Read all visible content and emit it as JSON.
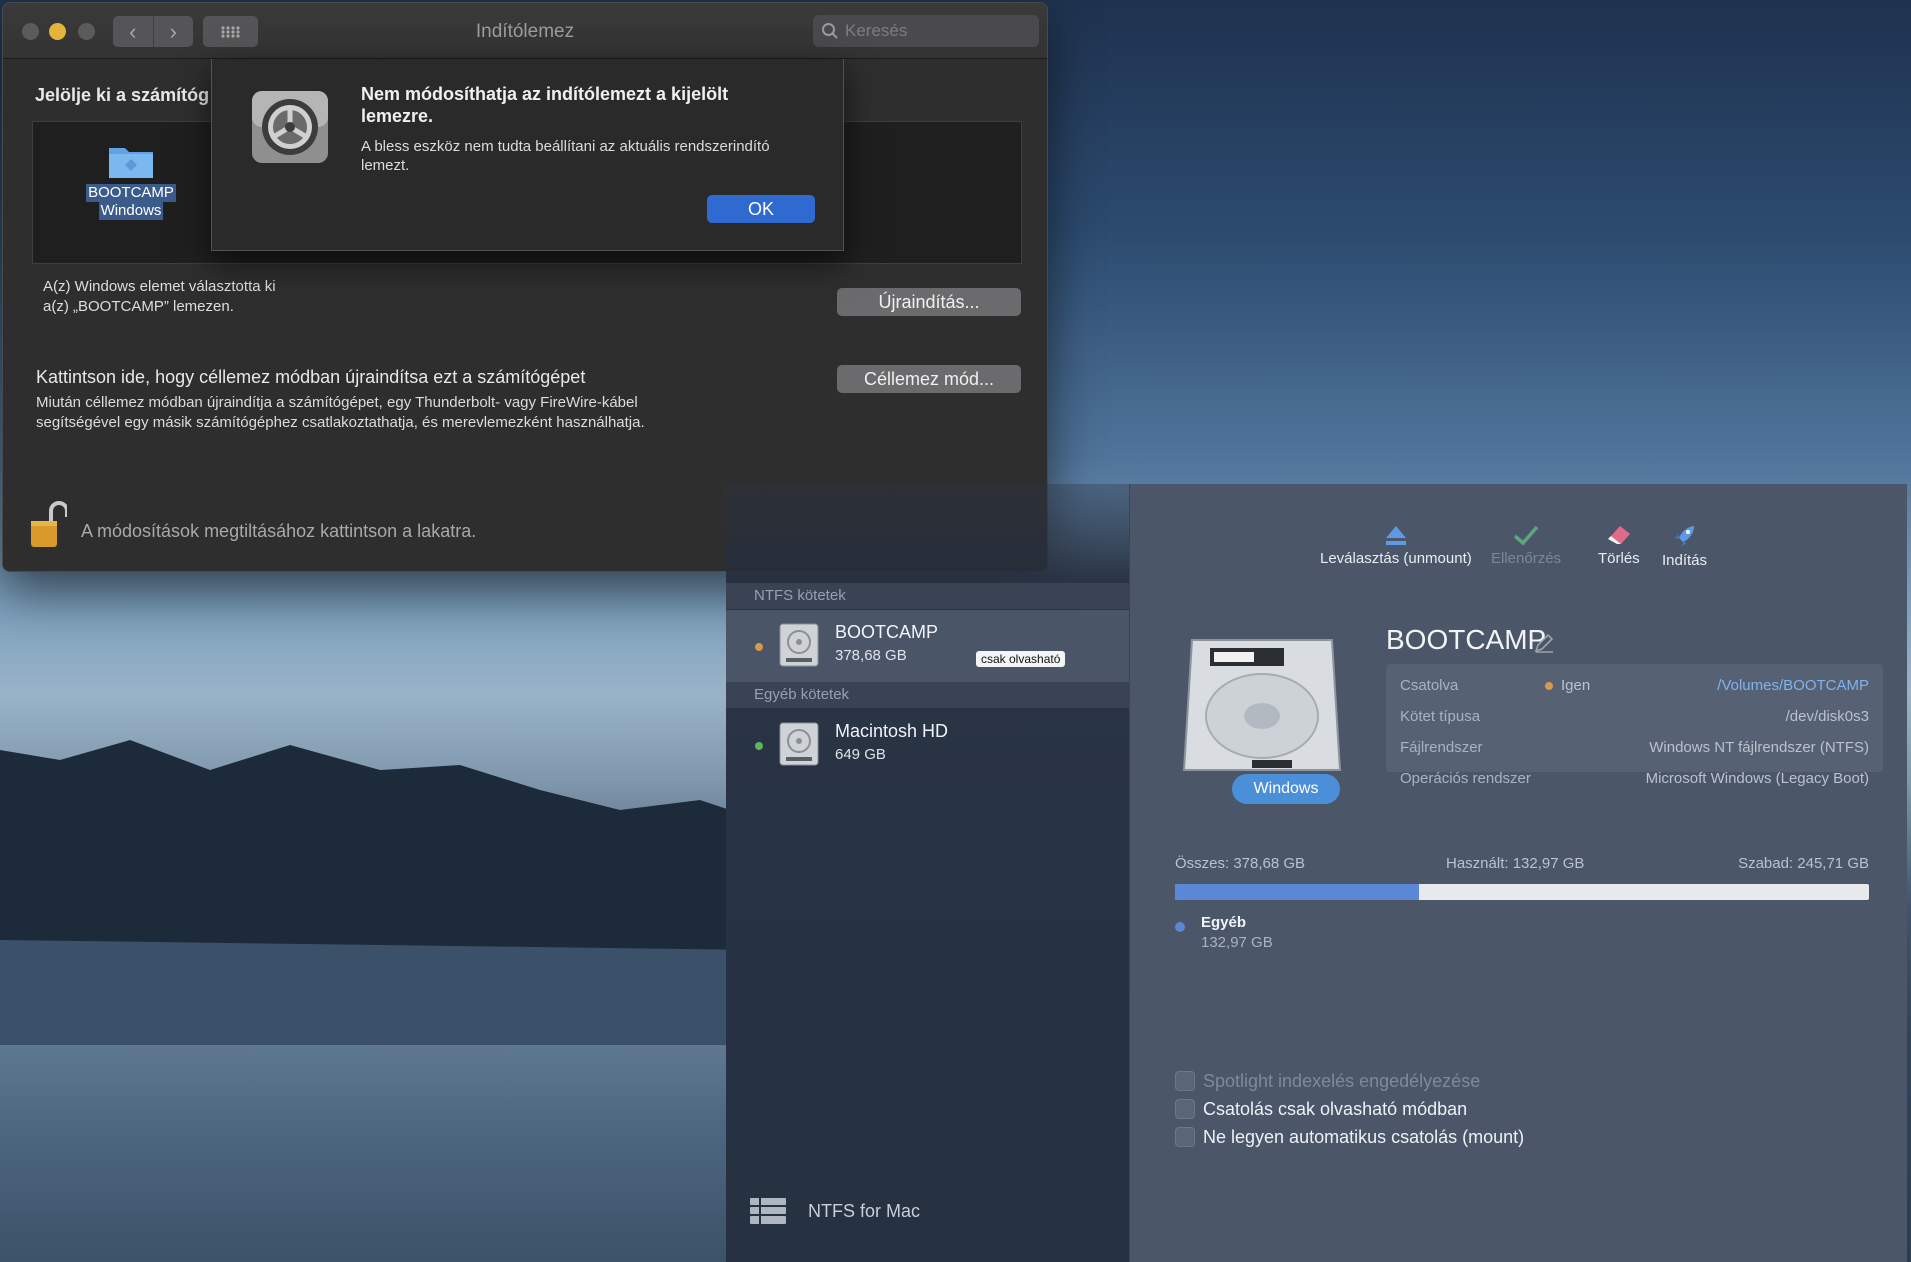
{
  "system_prefs": {
    "title": "Indítólemez",
    "search_placeholder": "Keresés",
    "heading": "Jelölje ki a számítóg",
    "disk": {
      "line1": "BOOTCAMP",
      "line2": "Windows"
    },
    "chosen_line1": "A(z) Windows elemet választotta ki",
    "chosen_line2": "a(z) „BOOTCAMP” lemezen.",
    "restart_button": "Újraindítás...",
    "target_title": "Kattintson ide, hogy céllemez módban újraindítsa ezt a számítógépet",
    "target_desc_line1": "Miután céllemez módban újraindítja a számítógépet, egy Thunderbolt- vagy FireWire-kábel",
    "target_desc_line2": "segítségével egy másik számítógéphez csatlakoztathatja, és merevlemezként használhatja.",
    "target_button": "Céllemez mód...",
    "lock_text": "A módosítások megtiltásához kattintson a lakatra."
  },
  "alert": {
    "title": "Nem módosíthatja az indítólemezt a kijelölt lemezre.",
    "message": "A bless eszköz nem tudta beállítani az aktuális rendszerindító lemezt.",
    "ok": "OK"
  },
  "ntfs": {
    "toolbar": {
      "unmount": "Leválasztás (unmount)",
      "verify": "Ellenőrzés",
      "erase": "Törlés",
      "launch": "Indítás"
    },
    "sections": {
      "ntfs": "NTFS kötetek",
      "other": "Egyéb kötetek"
    },
    "volumes": [
      {
        "name": "BOOTCAMP",
        "size": "378,68 GB",
        "badge": "csak olvasható",
        "dot_color": "#d39b4b"
      },
      {
        "name": "Macintosh HD",
        "size": "649 GB",
        "dot_color": "#5fb35a"
      }
    ],
    "brand": "NTFS for Mac",
    "detail": {
      "title": "BOOTCAMP",
      "os_tag": "Windows",
      "rows": [
        {
          "label": "Csatolva",
          "mid": "Igen",
          "value": "/Volumes/BOOTCAMP"
        },
        {
          "label": "Kötet típusa",
          "value": "/dev/disk0s3"
        },
        {
          "label": "Fájlrendszer",
          "value": "Windows NT fájlrendszer (NTFS)"
        },
        {
          "label": "Operációs rendszer",
          "value": "Microsoft Windows (Legacy Boot)"
        }
      ],
      "total": "Összes: 378,68 GB",
      "used": "Használt: 132,97 GB",
      "free": "Szabad: 245,71 GB",
      "used_fraction": 0.351,
      "legend_name": "Egyéb",
      "legend_size": "132,97 GB",
      "options": [
        "Spotlight indexelés engedélyezése",
        "Csatolás csak olvasható módban",
        "Ne legyen automatikus csatolás (mount)"
      ]
    }
  }
}
